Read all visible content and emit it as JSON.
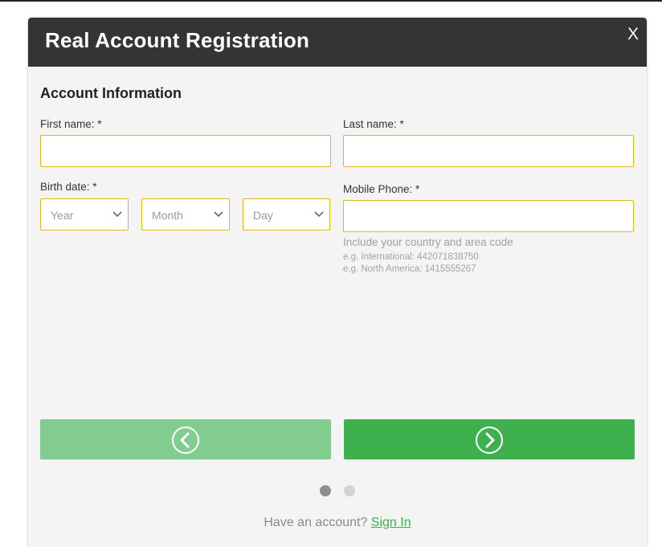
{
  "modal": {
    "title": "Real Account Registration",
    "close_label": "X"
  },
  "form": {
    "section_title": "Account Information",
    "first_name": {
      "label": "First name: *",
      "value": "",
      "placeholder": ""
    },
    "last_name": {
      "label": "Last name: *",
      "value": "",
      "placeholder": ""
    },
    "birth_date": {
      "label": "Birth date: *",
      "year": "Year",
      "month": "Month",
      "day": "Day"
    },
    "mobile_phone": {
      "label": "Mobile Phone: *",
      "value": "",
      "placeholder": "",
      "hint": "Include your country and area code",
      "example_international": "e.g. International: 442071838750",
      "example_north_america": "e.g. North America: 1415555267"
    }
  },
  "navigation": {
    "prev_icon": "chevron-left-circle-icon",
    "next_icon": "chevron-right-circle-icon",
    "steps_total": 2,
    "current_step": 1
  },
  "footer": {
    "prompt": "Have an account? ",
    "sign_in": "Sign In"
  },
  "colors": {
    "header_bg": "#343434",
    "input_border": "#e3b718",
    "prev_button": "#82cc8f",
    "next_button": "#3eb14e",
    "link": "#3cae48"
  }
}
